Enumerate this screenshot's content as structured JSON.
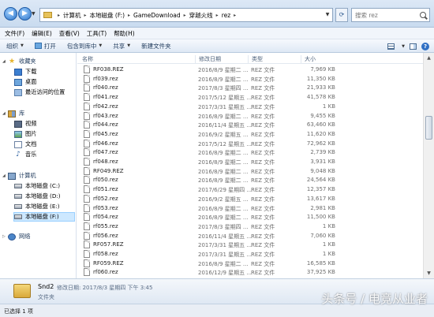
{
  "address": {
    "crumbs": [
      "计算机",
      "本地磁盘 (F:)",
      "GameDownload",
      "穿越火线",
      "rez"
    ]
  },
  "search": {
    "placeholder": "搜索 rez"
  },
  "menu": [
    "文件(F)",
    "编辑(E)",
    "查看(V)",
    "工具(T)",
    "帮助(H)"
  ],
  "toolbar": {
    "organize": "组织",
    "open": "打开",
    "include_library": "包含到库中",
    "share": "共享",
    "new_folder": "新建文件夹"
  },
  "nav": {
    "favorites": "收藏夹",
    "downloads": "下载",
    "desktop": "桌面",
    "recent": "最近访问的位置",
    "libraries": "库",
    "videos": "视频",
    "pictures": "图片",
    "documents": "文档",
    "music": "音乐",
    "computer": "计算机",
    "drive_c": "本地磁盘 (C:)",
    "drive_d": "本地磁盘 (D:)",
    "drive_e": "本地磁盘 (E:)",
    "drive_f": "本地磁盘 (F:)",
    "network": "网络"
  },
  "columns": {
    "name": "名称",
    "date": "修改日期",
    "type": "类型",
    "size": "大小"
  },
  "files": [
    {
      "name": "RF038.REZ",
      "date": "2016/8/9 星期二 ...",
      "type": "REZ 文件",
      "size": "7,969 KB"
    },
    {
      "name": "rf039.rez",
      "date": "2016/8/9 星期二 ...",
      "type": "REZ 文件",
      "size": "11,350 KB"
    },
    {
      "name": "rf040.rez",
      "date": "2017/8/3 星期四 ...",
      "type": "REZ 文件",
      "size": "21,933 KB"
    },
    {
      "name": "rf041.rez",
      "date": "2017/5/12 星期五 ...",
      "type": "REZ 文件",
      "size": "41,578 KB"
    },
    {
      "name": "rf042.rez",
      "date": "2017/3/31 星期五 ...",
      "type": "REZ 文件",
      "size": "1 KB"
    },
    {
      "name": "rf043.rez",
      "date": "2016/8/9 星期二 ...",
      "type": "REZ 文件",
      "size": "9,455 KB"
    },
    {
      "name": "rf044.rez",
      "date": "2016/11/4 星期五 ...",
      "type": "REZ 文件",
      "size": "63,460 KB"
    },
    {
      "name": "rf045.rez",
      "date": "2016/9/2 星期五 ...",
      "type": "REZ 文件",
      "size": "11,620 KB"
    },
    {
      "name": "rf046.rez",
      "date": "2017/5/12 星期五 ...",
      "type": "REZ 文件",
      "size": "72,962 KB"
    },
    {
      "name": "rf047.rez",
      "date": "2016/8/9 星期二 ...",
      "type": "REZ 文件",
      "size": "2,739 KB"
    },
    {
      "name": "rf048.rez",
      "date": "2016/8/9 星期二 ...",
      "type": "REZ 文件",
      "size": "3,931 KB"
    },
    {
      "name": "RF049.REZ",
      "date": "2016/8/9 星期二 ...",
      "type": "REZ 文件",
      "size": "9,048 KB"
    },
    {
      "name": "rf050.rez",
      "date": "2016/8/9 星期二 ...",
      "type": "REZ 文件",
      "size": "24,564 KB"
    },
    {
      "name": "rf051.rez",
      "date": "2017/6/29 星期四 ...",
      "type": "REZ 文件",
      "size": "12,357 KB"
    },
    {
      "name": "rf052.rez",
      "date": "2016/9/2 星期五 ...",
      "type": "REZ 文件",
      "size": "13,617 KB"
    },
    {
      "name": "rf053.rez",
      "date": "2016/8/9 星期二 ...",
      "type": "REZ 文件",
      "size": "2,981 KB"
    },
    {
      "name": "rf054.rez",
      "date": "2016/8/9 星期二 ...",
      "type": "REZ 文件",
      "size": "11,500 KB"
    },
    {
      "name": "rf055.rez",
      "date": "2017/8/3 星期四 ...",
      "type": "REZ 文件",
      "size": "1 KB"
    },
    {
      "name": "rf056.rez",
      "date": "2016/11/4 星期五 ...",
      "type": "REZ 文件",
      "size": "7,060 KB"
    },
    {
      "name": "RF057.REZ",
      "date": "2017/3/31 星期五 ...",
      "type": "REZ 文件",
      "size": "1 KB"
    },
    {
      "name": "rf058.rez",
      "date": "2017/3/31 星期五 ...",
      "type": "REZ 文件",
      "size": "1 KB"
    },
    {
      "name": "RF059.REZ",
      "date": "2016/8/9 星期二 ...",
      "type": "REZ 文件",
      "size": "16,585 KB"
    },
    {
      "name": "rf060.rez",
      "date": "2016/12/9 星期五 ...",
      "type": "REZ 文件",
      "size": "37,925 KB"
    }
  ],
  "details": {
    "name": "Snd2",
    "meta": "修改日期: 2017/8/3 星期四 下午 3:45",
    "type": "文件夹"
  },
  "status": {
    "text": "已选择 1 项"
  },
  "watermark": "头条号 / 电竞从业者"
}
